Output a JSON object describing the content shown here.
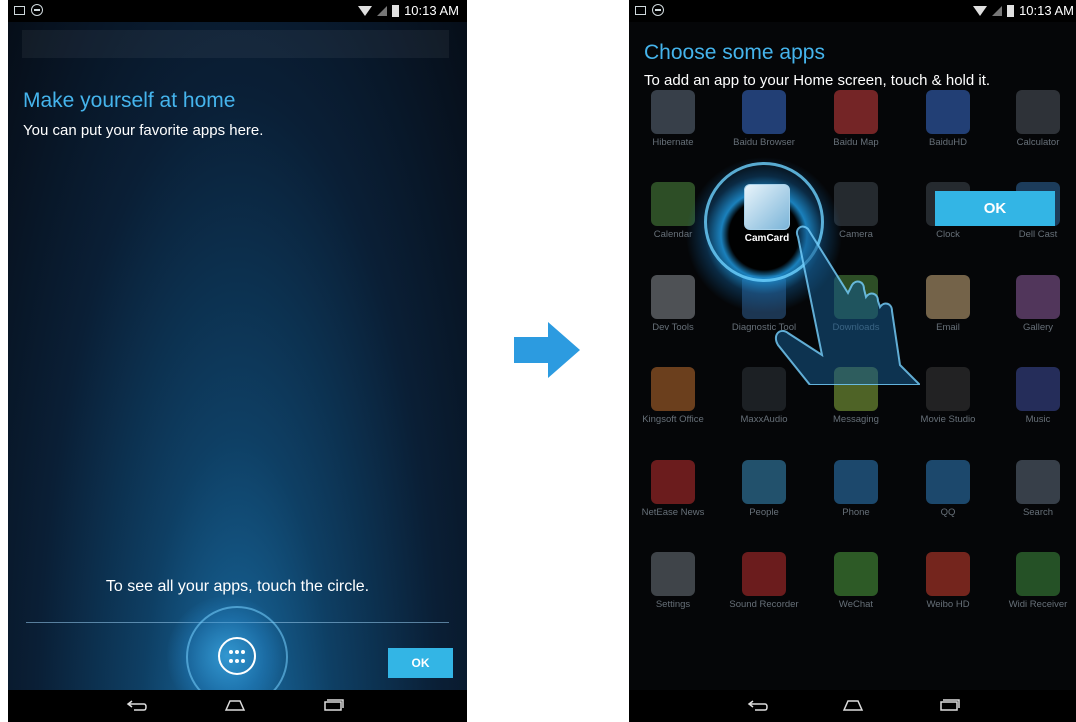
{
  "status_bar": {
    "time": "10:13 AM"
  },
  "left_screen": {
    "title": "Make yourself at home",
    "subtitle": "You can put your favorite apps here.",
    "hint": "To see all your apps, touch the circle.",
    "ok_label": "OK"
  },
  "right_screen": {
    "title": "Choose some apps",
    "subtitle": "To add an app to your Home screen, touch & hold it.",
    "ok_label": "OK",
    "focused_app": "CamCard",
    "apps": [
      {
        "label": "Hibernate",
        "color": "#607080"
      },
      {
        "label": "Baidu Browser",
        "color": "#3b6fd0"
      },
      {
        "label": "Baidu Map",
        "color": "#d04040"
      },
      {
        "label": "BaiduHD",
        "color": "#3b6fd0"
      },
      {
        "label": "Calculator",
        "color": "#505860"
      },
      {
        "label": "Calendar",
        "color": "#4f8a3f"
      },
      {
        "label": "CamCard",
        "color": "#7ab4d8"
      },
      {
        "label": "Camera",
        "color": "#404850"
      },
      {
        "label": "Clock",
        "color": "#404850"
      },
      {
        "label": "Dell Cast",
        "color": "#2f6aa0"
      },
      {
        "label": "Dev Tools",
        "color": "#8a8f95"
      },
      {
        "label": "Diagnostic Tool",
        "color": "#2f5f8f"
      },
      {
        "label": "Downloads",
        "color": "#4f8a3f"
      },
      {
        "label": "Email",
        "color": "#d0b080"
      },
      {
        "label": "Gallery",
        "color": "#8f5fa0"
      },
      {
        "label": "Kingsoft Office",
        "color": "#c07030"
      },
      {
        "label": "MaxxAudio",
        "color": "#30363c"
      },
      {
        "label": "Messaging",
        "color": "#8ab040"
      },
      {
        "label": "Movie Studio",
        "color": "#3a3a3a"
      },
      {
        "label": "Music",
        "color": "#3f4f9f"
      },
      {
        "label": "NetEase News",
        "color": "#c03030"
      },
      {
        "label": "People",
        "color": "#3a8fc0"
      },
      {
        "label": "Phone",
        "color": "#2f7fbf"
      },
      {
        "label": "QQ",
        "color": "#2f7fbf"
      },
      {
        "label": "Search",
        "color": "#607080"
      },
      {
        "label": "Settings",
        "color": "#707880"
      },
      {
        "label": "Sound Recorder",
        "color": "#c03030"
      },
      {
        "label": "WeChat",
        "color": "#4fa040"
      },
      {
        "label": "Weibo HD",
        "color": "#d04030"
      },
      {
        "label": "Widi Receiver",
        "color": "#3f8f3f"
      }
    ]
  },
  "colors": {
    "accent": "#33b5e5",
    "title": "#45b4ec",
    "arrow": "#2c9be0"
  }
}
